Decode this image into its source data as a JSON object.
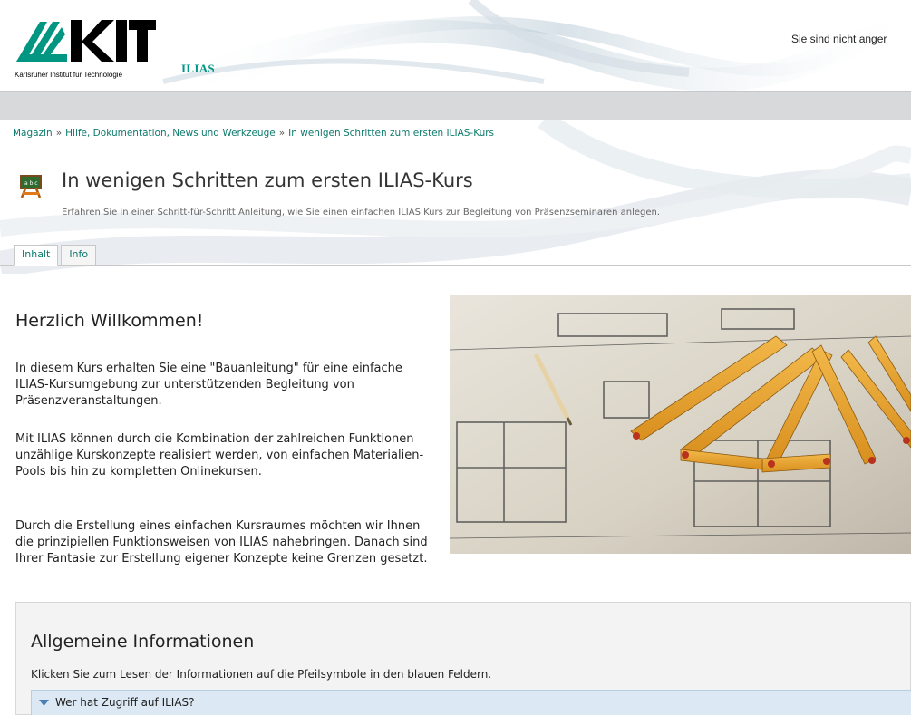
{
  "header": {
    "logo_subtitle": "Karlsruher Institut für Technologie",
    "app_name": "ILIAS",
    "login_status": "Sie sind nicht anger"
  },
  "breadcrumb": [
    "Magazin",
    "Hilfe, Dokumentation, News und Werkzeuge",
    "In wenigen Schritten zum ersten ILIAS-Kurs"
  ],
  "breadcrumb_separator": "»",
  "page": {
    "title": "In wenigen Schritten zum ersten ILIAS-Kurs",
    "description": "Erfahren Sie in einer Schritt-für-Schritt Anleitung, wie Sie einen einfachen ILIAS Kurs zur Begleitung von Präsenzseminaren anlegen."
  },
  "tabs": [
    {
      "label": "Inhalt",
      "active": true
    },
    {
      "label": "Info",
      "active": false
    }
  ],
  "welcome": {
    "heading": "Herzlich Willkommen!",
    "paragraphs": [
      "In diesem Kurs erhalten Sie eine \"Bauanleitung\" für eine einfache ILIAS-Kursumgebung zur unterstützenden Begleitung von Präsenzveranstaltungen.",
      "Mit ILIAS können durch die Kombination der zahlreichen Funktionen unzählige Kurskonzepte realisiert werden, von einfachen Materialien-Pools bis hin zu kompletten Onlinekursen.",
      "Durch die Erstellung eines einfachen Kursraumes möchten wir Ihnen die prinzipiellen Funktionsweisen von ILIAS nahebringen. Danach sind Ihrer Fantasie zur Erstellung eigener Konzepte keine Grenzen gesetzt."
    ]
  },
  "info_box": {
    "heading": "Allgemeine Informationen",
    "subtitle": "Klicken Sie zum Lesen der Informationen auf die Pfeilsymbole in den blauen Feldern.",
    "accordion_label": "Wer hat Zugriff auf ILIAS?"
  },
  "colors": {
    "brand_green": "#009682",
    "link": "#0c7a6c",
    "accordion_bg": "#dce8f3"
  },
  "icons": {
    "title_icon": "course-blackboard-icon",
    "accordion_icon": "triangle-down-icon"
  }
}
